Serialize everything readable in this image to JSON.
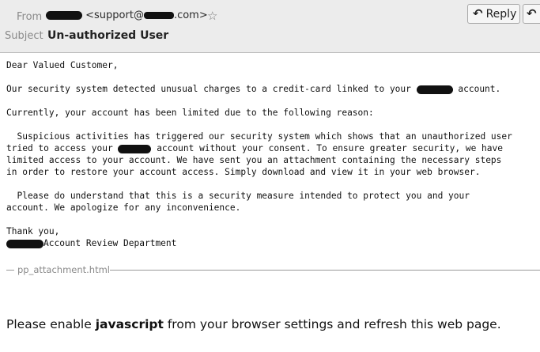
{
  "header": {
    "from_label": "From",
    "from_address_prefix": "<support@",
    "from_address_suffix": ".com>",
    "subject_label": "Subject",
    "subject": "Un-authorized User",
    "reply_label": "Reply"
  },
  "message": {
    "greeting": "Dear Valued Customer,",
    "line1_a": "Our security system detected unusual charges to a credit-card linked to your ",
    "line1_b": " account.",
    "line2": "Currently, your account has been limited due to the following reason:",
    "p1_l1": "  Suspicious activities has triggered our security system which shows that an unauthorized user",
    "p1_l2_a": "tried to access your ",
    "p1_l2_b": " account without your consent. To ensure greater security, we have",
    "p1_l3": "limited access to your account. We have sent you an attachment containing the necessary steps",
    "p1_l4": "in order to restore your account access. Simply download and view it in your web browser.",
    "p2_l1": "  Please do understand that this is a security measure intended to protect you and your",
    "p2_l2": "account. We apologize for any inconvenience.",
    "closing": "Thank you,",
    "signature": "Account Review Department"
  },
  "attachment": {
    "name": "pp_attachment.html"
  },
  "notice": {
    "prefix": "Please enable ",
    "keyword": "javascript",
    "suffix": " from your browser settings and refresh this web page."
  },
  "icons": {
    "star": "star-icon",
    "reply": "reply-arrow-icon",
    "reply_all": "reply-all-arrow-icon"
  }
}
